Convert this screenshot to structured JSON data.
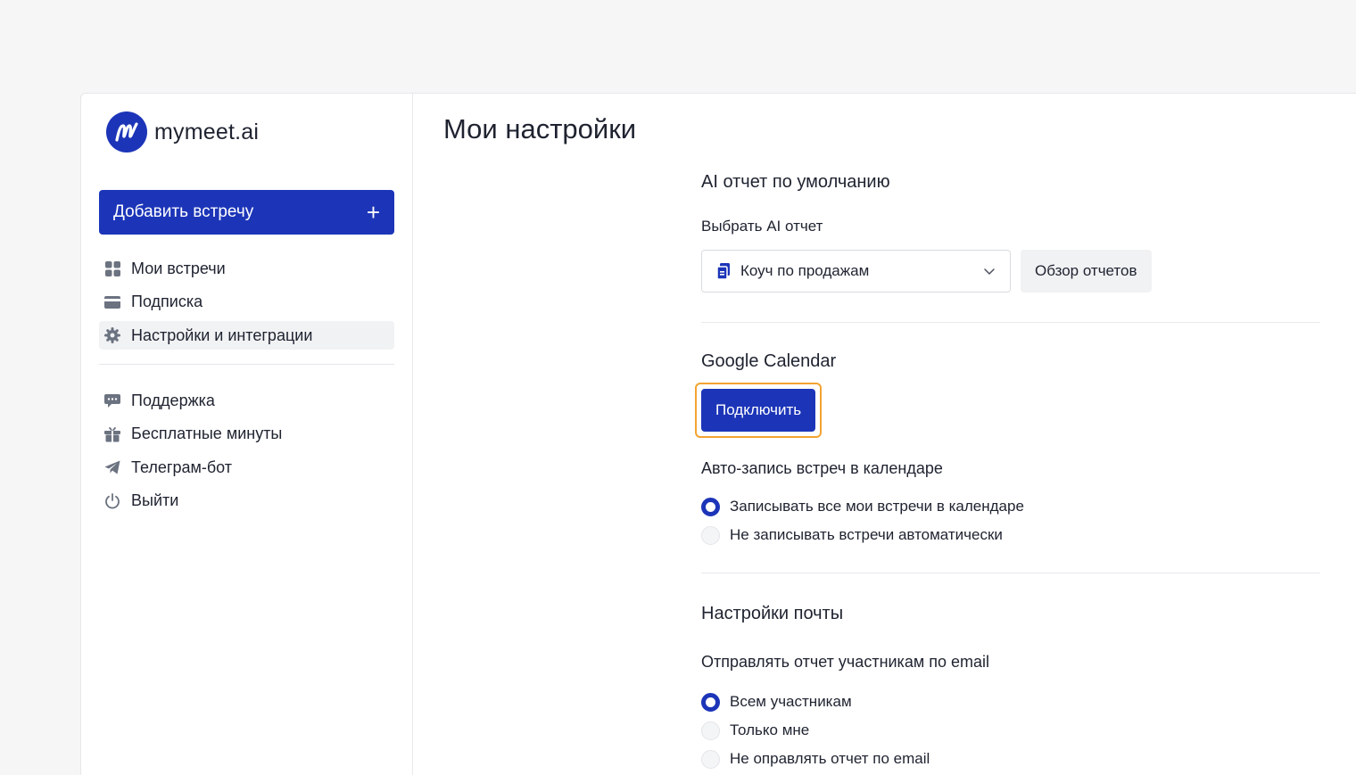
{
  "brand": {
    "name": "mymeet.ai"
  },
  "sidebar": {
    "add_button": {
      "label": "Добавить встречу",
      "icon": "plus-icon"
    },
    "items": [
      {
        "label": "Мои встречи",
        "icon": "grid-icon"
      },
      {
        "label": "Подписка",
        "icon": "card-icon"
      },
      {
        "label": "Настройки и интеграции",
        "icon": "gear-icon",
        "active": true
      }
    ],
    "secondary_items": [
      {
        "label": "Поддержка",
        "icon": "chat-icon"
      },
      {
        "label": "Бесплатные минуты",
        "icon": "gift-icon"
      },
      {
        "label": "Телеграм-бот",
        "icon": "telegram-icon"
      },
      {
        "label": "Выйти",
        "icon": "power-icon"
      }
    ]
  },
  "main": {
    "title": "Мои настройки",
    "ai_report": {
      "title": "AI отчет по умолчанию",
      "select_label": "Выбрать AI отчет",
      "selected": "Коуч по продажам",
      "overview_button": "Обзор отчетов"
    },
    "google_calendar": {
      "title": "Google Calendar",
      "connect_button": "Подключить",
      "auto_record_title": "Авто-запись встреч в календаре",
      "options": [
        {
          "label": "Записывать все мои встречи в календаре",
          "selected": true
        },
        {
          "label": "Не записывать встречи автоматически",
          "selected": false
        }
      ]
    },
    "mail": {
      "title": "Настройки почты",
      "send_label": "Отправлять отчет участникам по email",
      "options": [
        {
          "label": "Всем участникам",
          "selected": true
        },
        {
          "label": "Только мне",
          "selected": false
        },
        {
          "label": "Не оправлять отчет по email",
          "selected": false
        }
      ]
    }
  },
  "colors": {
    "primary": "#1c35b8",
    "focus_ring": "#f3a332",
    "background": "#f6f6f7"
  }
}
